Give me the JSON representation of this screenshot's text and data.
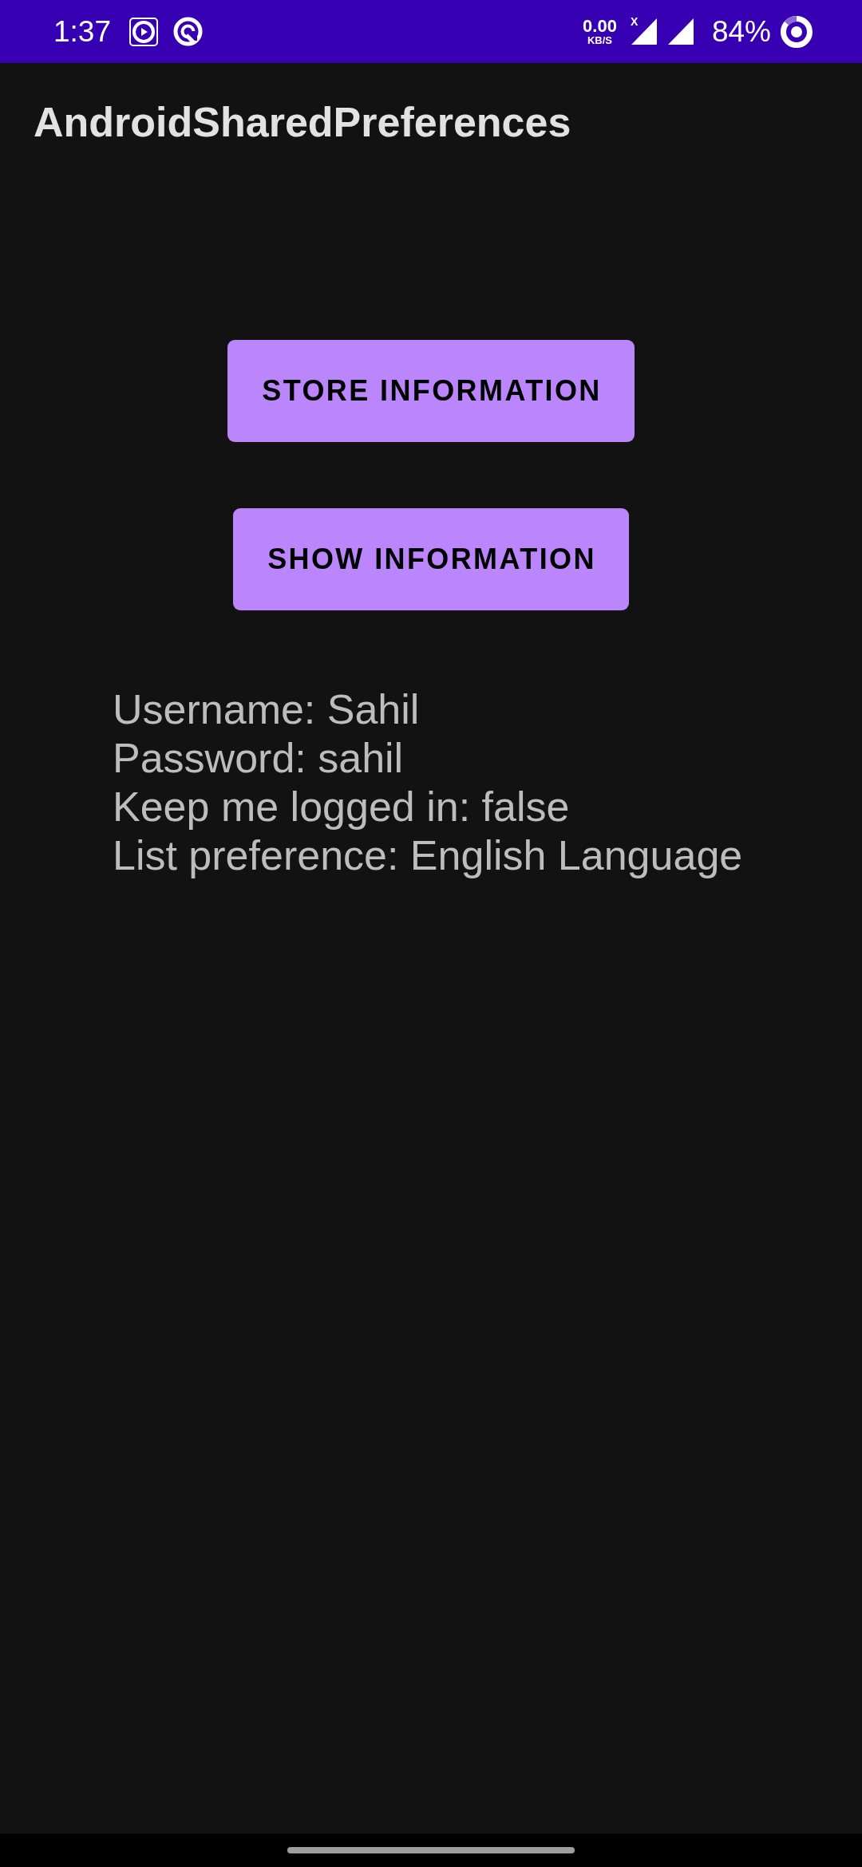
{
  "status_bar": {
    "time": "1:37",
    "data_speed": "0.00",
    "data_speed_unit": "KB/S",
    "signal_label": "X",
    "battery": "84%"
  },
  "app_bar": {
    "title": "AndroidSharedPreferences"
  },
  "buttons": [
    {
      "label": "STORE INFORMATION"
    },
    {
      "label": "SHOW INFORMATION"
    }
  ],
  "info_lines": [
    "Username: Sahil",
    "Password: sahil",
    "Keep me logged in: false",
    "List preference: English Language"
  ]
}
